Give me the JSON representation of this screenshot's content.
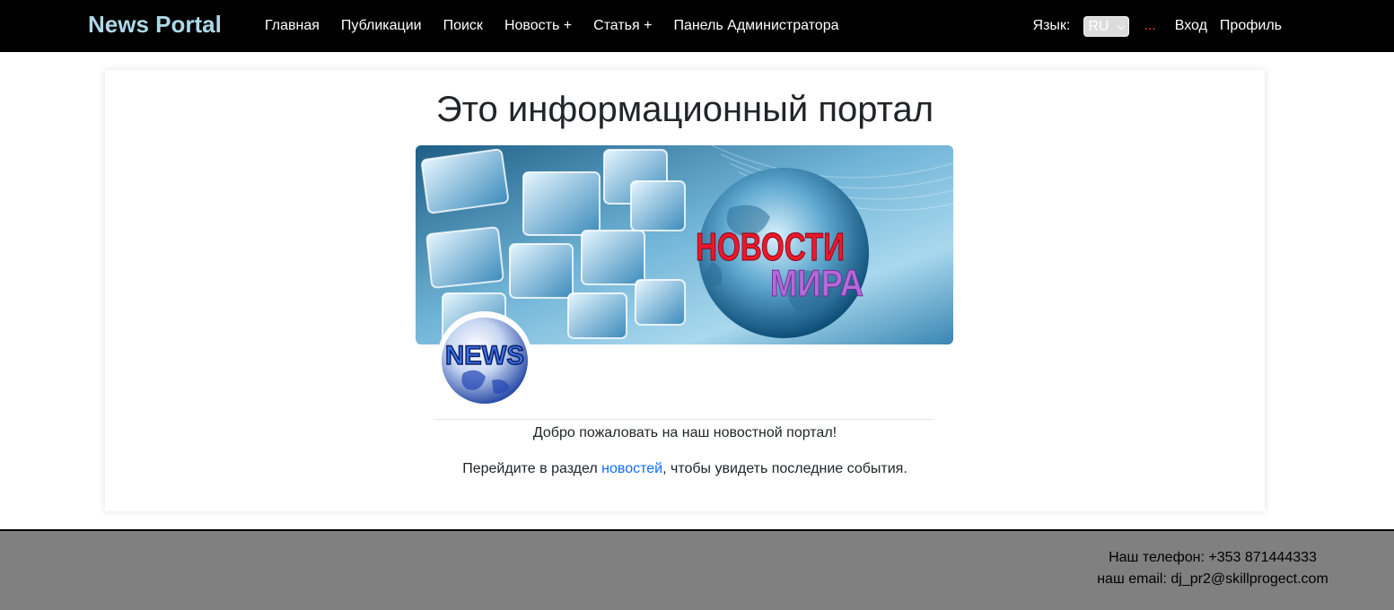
{
  "navbar": {
    "brand": "News Portal",
    "links": [
      "Главная",
      "Публикации",
      "Поиск",
      "Новость +",
      "Статья +",
      "Панель Администратора"
    ],
    "lang_label": "Язык:",
    "lang_value": "RU",
    "dots": "...",
    "login": "Вход",
    "profile": "Профиль",
    "colors": {
      "background": "#000000",
      "brand": "#add8e6",
      "dots": "#ff3b30"
    }
  },
  "hero": {
    "title": "Это информационный портал",
    "banner_text_line1": "НОВОСТИ",
    "banner_text_line2": "МИРА",
    "logo_text": "NEWS"
  },
  "content": {
    "welcome": "Добро пожаловать на наш новостной портал!",
    "goto_before": "Перейдите в раздел ",
    "goto_link": "новостей",
    "goto_after": ", чтобы увидеть последние события."
  },
  "footer": {
    "phone": "Наш телефон: +353 871444333",
    "email": "наш email: dj_pr2@skillprogect.com",
    "background": "#808080"
  }
}
